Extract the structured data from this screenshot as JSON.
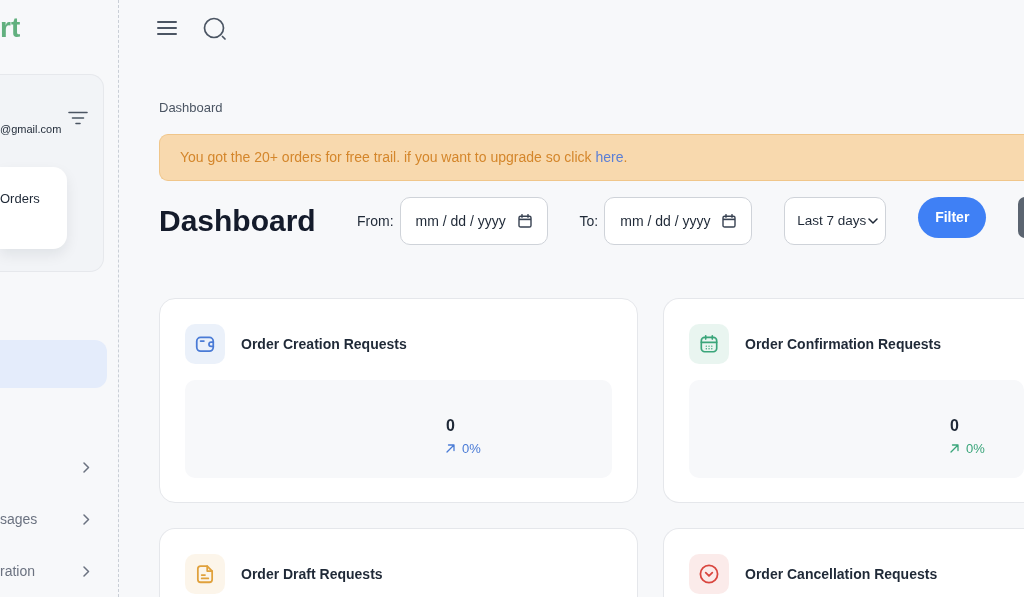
{
  "sidebar": {
    "logo": "rt",
    "profile": {
      "email": "@gmail.com",
      "menu_card": "Orders"
    },
    "nav": [
      {
        "selected": true,
        "expandable": false
      },
      {
        "selected": false,
        "expandable": true
      },
      {
        "label": "sages",
        "selected": false,
        "expandable": true
      },
      {
        "label": "ration",
        "selected": false,
        "expandable": true
      }
    ]
  },
  "breadcrumb": "Dashboard",
  "alert": {
    "text": "You got the 20+ orders for free trail. if you want to upgrade so click ",
    "link": "here",
    "after": "."
  },
  "header": {
    "title": "Dashboard",
    "from": {
      "label": "From:",
      "placeholder": "mm / dd / yyyy"
    },
    "to": {
      "label": "To:",
      "placeholder": "mm / dd / yyyy"
    },
    "range": {
      "value": "Last 7 days"
    },
    "filter_button": "Filter"
  },
  "cards": [
    {
      "title": "Order Creation Requests",
      "color": "#4a7bd6",
      "value": "0",
      "change": "0%"
    },
    {
      "title": "Order Confirmation Requests",
      "color": "#3aa57a",
      "value": "0",
      "change": "0%"
    },
    {
      "title": "Order Draft Requests",
      "color": "#e0a13c"
    },
    {
      "title": "Order Cancellation Requests",
      "color": "#d9463f"
    }
  ]
}
